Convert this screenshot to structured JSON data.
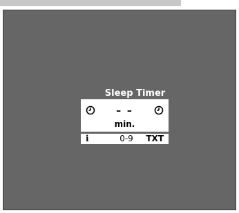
{
  "osd": {
    "title": "Sleep Timer",
    "value": "– –",
    "unit": "min.",
    "icons": [
      "clock-icon",
      "clock-icon"
    ]
  },
  "info_bar": {
    "info_glyph": "i",
    "range": "0-9",
    "txt": "TXT"
  },
  "colors": {
    "screen_bg": "#666666",
    "panel_bg": "#ffffff",
    "text": "#000000",
    "title_text": "#ffffff"
  }
}
